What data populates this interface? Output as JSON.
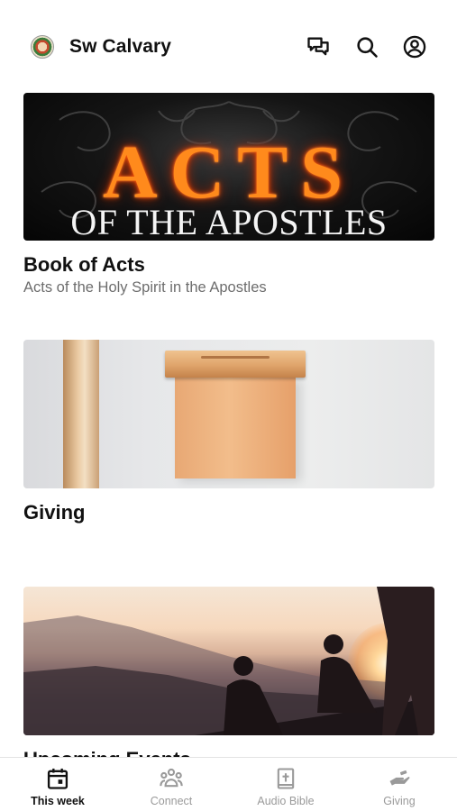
{
  "header": {
    "title": "Sw Calvary",
    "logo_icon": "church-logo-icon",
    "icons": [
      "chat-bubbles-icon",
      "search-icon",
      "account-icon"
    ]
  },
  "feed": [
    {
      "image": {
        "main_text": "ACTS",
        "sub_text": "OF THE APOSTLES"
      },
      "title": "Book of Acts",
      "subtitle": "Acts of the Holy Spirit in the Apostles"
    },
    {
      "title": "Giving"
    },
    {
      "title": "Upcoming Events"
    }
  ],
  "tabs": [
    {
      "label": "This week",
      "icon": "calendar-icon",
      "active": true
    },
    {
      "label": "Connect",
      "icon": "people-group-icon",
      "active": false
    },
    {
      "label": "Audio Bible",
      "icon": "bible-icon",
      "active": false
    },
    {
      "label": "Giving",
      "icon": "giving-hand-icon",
      "active": false
    }
  ],
  "colors": {
    "text": "#111111",
    "muted": "#6d6d6d",
    "tab_inactive": "#9a9a9a",
    "divider": "#e3e3e3"
  }
}
